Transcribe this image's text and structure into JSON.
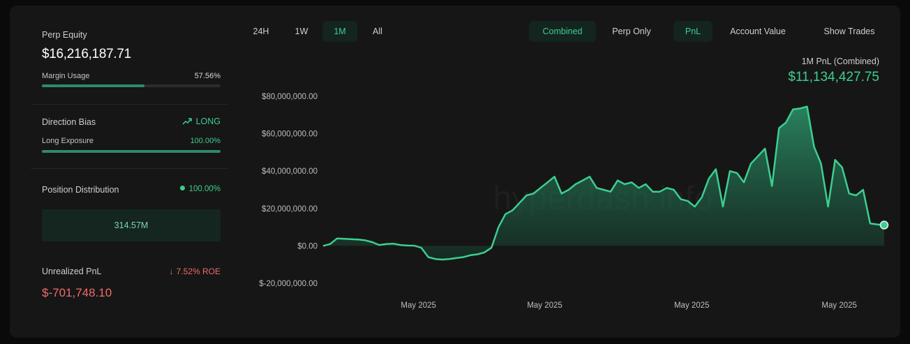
{
  "summary": {
    "perp_equity_label": "Perp Equity",
    "perp_equity_value": "$16,216,187.71",
    "margin_usage_label": "Margin Usage",
    "margin_usage_value": "57.56%",
    "margin_usage_fraction": 0.5756,
    "direction_bias_label": "Direction Bias",
    "direction_bias_value": "LONG",
    "long_exposure_label": "Long Exposure",
    "long_exposure_value": "100.00%",
    "long_exposure_fraction": 1.0,
    "position_distribution_label": "Position Distribution",
    "position_distribution_value": "100.00%",
    "position_distribution_amount": "314.57M",
    "unrealized_pnl_label": "Unrealized PnL",
    "unrealized_pnl_roe": "7.52% ROE",
    "unrealized_pnl_value": "$-701,748.10"
  },
  "toolbar": {
    "timeframes": [
      "24H",
      "1W",
      "1M",
      "All"
    ],
    "selected_timeframe": "1M",
    "mode_combined": "Combined",
    "mode_perp_only": "Perp Only",
    "metric_pnl": "PnL",
    "metric_account_value": "Account Value",
    "show_trades": "Show Trades"
  },
  "chart_header": {
    "label": "1M PnL (Combined)",
    "value": "$11,134,427.75"
  },
  "watermark": "hyperdash.info",
  "colors": {
    "accent": "#3ccf91",
    "negative": "#ef6b6b",
    "background": "#161616"
  },
  "chart_data": {
    "type": "area",
    "title": "1M PnL (Combined)",
    "xlabel": "",
    "ylabel": "",
    "ylim": [
      -20000000,
      80000000
    ],
    "y_ticks": [
      -20000000,
      0,
      20000000,
      40000000,
      60000000,
      80000000
    ],
    "y_tick_labels": [
      "$-20,000,000.00",
      "$0.00",
      "$20,000,000.00",
      "$40,000,000.00",
      "$60,000,000.00",
      "$80,000,000.00"
    ],
    "x_tick_labels": [
      "May 2025",
      "May 2025",
      "May 2025",
      "May 2025"
    ],
    "x_tick_positions": [
      0.17,
      0.395,
      0.657,
      0.92
    ],
    "grid": false,
    "series": [
      {
        "values": [
          0,
          1000000,
          4000000,
          3800000,
          3600000,
          3400000,
          3000000,
          2000000,
          500000,
          1000000,
          1200000,
          500000,
          200000,
          100000,
          -1000000,
          -6000000,
          -7000000,
          -7300000,
          -7000000,
          -6500000,
          -6000000,
          -5000000,
          -4500000,
          -3500000,
          -1000000,
          10000000,
          17000000,
          19000000,
          23000000,
          27000000,
          28000000,
          31000000,
          34000000,
          37000000,
          28000000,
          30000000,
          33000000,
          35000000,
          37000000,
          31000000,
          30000000,
          29000000,
          35000000,
          33000000,
          34000000,
          31000000,
          33000000,
          29000000,
          29000000,
          31000000,
          30000000,
          25000000,
          24000000,
          21000000,
          26000000,
          36000000,
          41000000,
          21000000,
          40000000,
          39000000,
          34000000,
          44000000,
          48000000,
          52000000,
          32000000,
          63000000,
          66000000,
          73000000,
          73500000,
          74500000,
          53000000,
          44000000,
          21000000,
          46000000,
          42000000,
          28000000,
          27000000,
          30000000,
          12000000,
          11500000,
          11134427
        ]
      }
    ]
  }
}
